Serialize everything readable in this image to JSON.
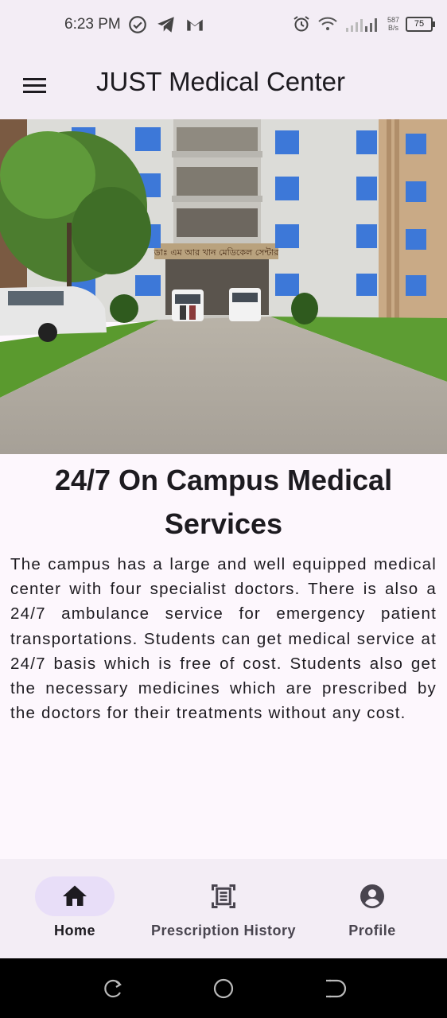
{
  "status_bar": {
    "time": "6:23 PM",
    "left_icons": [
      "check-circle-icon",
      "telegram-icon",
      "gmail-icon"
    ],
    "right_icons": [
      "alarm-icon",
      "wifi-icon",
      "signal-icon"
    ],
    "net_speed_value": "587",
    "net_speed_unit": "B/s",
    "battery": "75"
  },
  "app_bar": {
    "title": "JUST Medical Center",
    "menu_icon": "menu-icon"
  },
  "hero_image": {
    "description": "medical-center-building-photo",
    "sign_text": "ডাঃ এম আর খান মেডিকেল সেন্টার"
  },
  "content": {
    "heading": "24/7 On Campus Medical Services",
    "body": "The campus has a large and well equipped medical center with four specialist doctors. There is also a 24/7 ambulance service for emergency patient transportations. Students can get medical service at 24/7 basis which is free of cost. Students also get the necessary medicines which are prescribed by the doctors for their treatments without any cost."
  },
  "bottom_nav": {
    "items": [
      {
        "label": "Home",
        "icon": "home-icon",
        "active": true
      },
      {
        "label": "Prescription History",
        "icon": "receipt-icon",
        "active": false
      },
      {
        "label": "Profile",
        "icon": "account-circle-icon",
        "active": false
      }
    ]
  },
  "system_nav": [
    "recents-button",
    "home-button",
    "back-button"
  ],
  "colors": {
    "surface": "#fdf7fd",
    "bar": "#f3edf5",
    "active_pill": "#e8def8",
    "text": "#1d1b20"
  }
}
